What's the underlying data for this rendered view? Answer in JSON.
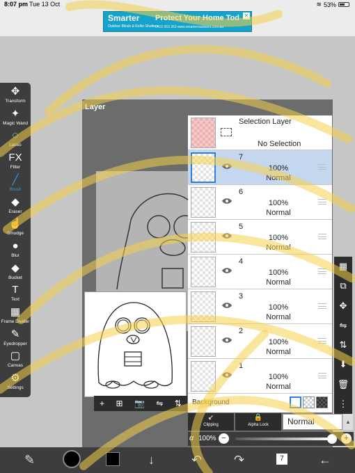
{
  "status_bar": {
    "time": "8:07 pm",
    "date": "Tue 13 Oct",
    "battery": "53%"
  },
  "ad": {
    "brand": "Smarter",
    "tagline": "Outdoor Blinds & Roller Shutters",
    "headline": "Protect Your Home Tod",
    "contact": "0415 063 363   www.smarteroutdoors.com.au",
    "close": "✕"
  },
  "toolbar": {
    "tools": [
      {
        "label": "Transform",
        "icon": "move-icon",
        "glyph": "✥"
      },
      {
        "label": "Magic Wand",
        "icon": "magic-wand-icon",
        "glyph": "✦"
      },
      {
        "label": "Lasso",
        "icon": "lasso-icon",
        "glyph": "◌"
      },
      {
        "label": "Filter",
        "icon": "fx-icon",
        "glyph": "FX"
      },
      {
        "label": "Brush",
        "icon": "brush-icon",
        "glyph": "╱",
        "active": true
      },
      {
        "label": "Eraser",
        "icon": "eraser-icon",
        "glyph": "◆"
      },
      {
        "label": "Smudge",
        "icon": "smudge-icon",
        "glyph": "☝"
      },
      {
        "label": "Blur",
        "icon": "blur-drop-icon",
        "glyph": "●"
      },
      {
        "label": "Bucket",
        "icon": "bucket-icon",
        "glyph": "◆"
      },
      {
        "label": "Text",
        "icon": "text-icon",
        "glyph": "T"
      },
      {
        "label": "Frame Divider",
        "icon": "frame-divider-icon",
        "glyph": "▦"
      },
      {
        "label": "Eyedropper",
        "icon": "eyedropper-icon",
        "glyph": "✎"
      },
      {
        "label": "Canvas",
        "icon": "canvas-icon",
        "glyph": "▢"
      },
      {
        "label": "Settings",
        "icon": "gear-icon",
        "glyph": "⚙"
      }
    ]
  },
  "layer_panel": {
    "title": "Layer",
    "selection_layer": {
      "title": "Selection Layer",
      "subtitle": "No Selection"
    },
    "layers": [
      {
        "number": "7",
        "opacity": "100%",
        "blend": "Normal",
        "selected": true
      },
      {
        "number": "6",
        "opacity": "100%",
        "blend": "Normal"
      },
      {
        "number": "5",
        "opacity": "100%",
        "blend": "Normal"
      },
      {
        "number": "4",
        "opacity": "100%",
        "blend": "Normal"
      },
      {
        "number": "3",
        "opacity": "100%",
        "blend": "Normal"
      },
      {
        "number": "2",
        "opacity": "100%",
        "blend": "Normal"
      },
      {
        "number": "1",
        "opacity": "100%",
        "blend": "Normal"
      }
    ],
    "background_label": "Background",
    "clipping_label": "Clipping",
    "alpha_lock_label": "Alpha Lock",
    "blend_mode": "Normal",
    "alpha_symbol": "α",
    "opacity_value": "100%",
    "opacity_fraction": 1.0,
    "mini_tools": [
      "+",
      "⊞",
      "📷",
      "⇋",
      "⇅"
    ],
    "layer_ops": [
      "▦",
      "⧉",
      "✥",
      "⇋",
      "⇅",
      "⬇",
      "🗑",
      "⋮"
    ]
  },
  "bottom_bar": {
    "items": [
      {
        "name": "brush-settings-icon",
        "glyph": "✎"
      },
      {
        "name": "color-circle-icon",
        "glyph": ""
      },
      {
        "name": "color-swatch-icon",
        "glyph": ""
      },
      {
        "name": "arrow-down-icon",
        "glyph": "↓"
      },
      {
        "name": "undo-icon",
        "glyph": "↶"
      },
      {
        "name": "redo-icon",
        "glyph": "↷"
      },
      {
        "name": "layers-icon",
        "glyph": "7"
      },
      {
        "name": "back-icon",
        "glyph": "←"
      }
    ]
  },
  "colors": {
    "accent": "#2b9cf0",
    "highlighter": "#f5d04a",
    "selected_layer": "#c4d7ef"
  }
}
